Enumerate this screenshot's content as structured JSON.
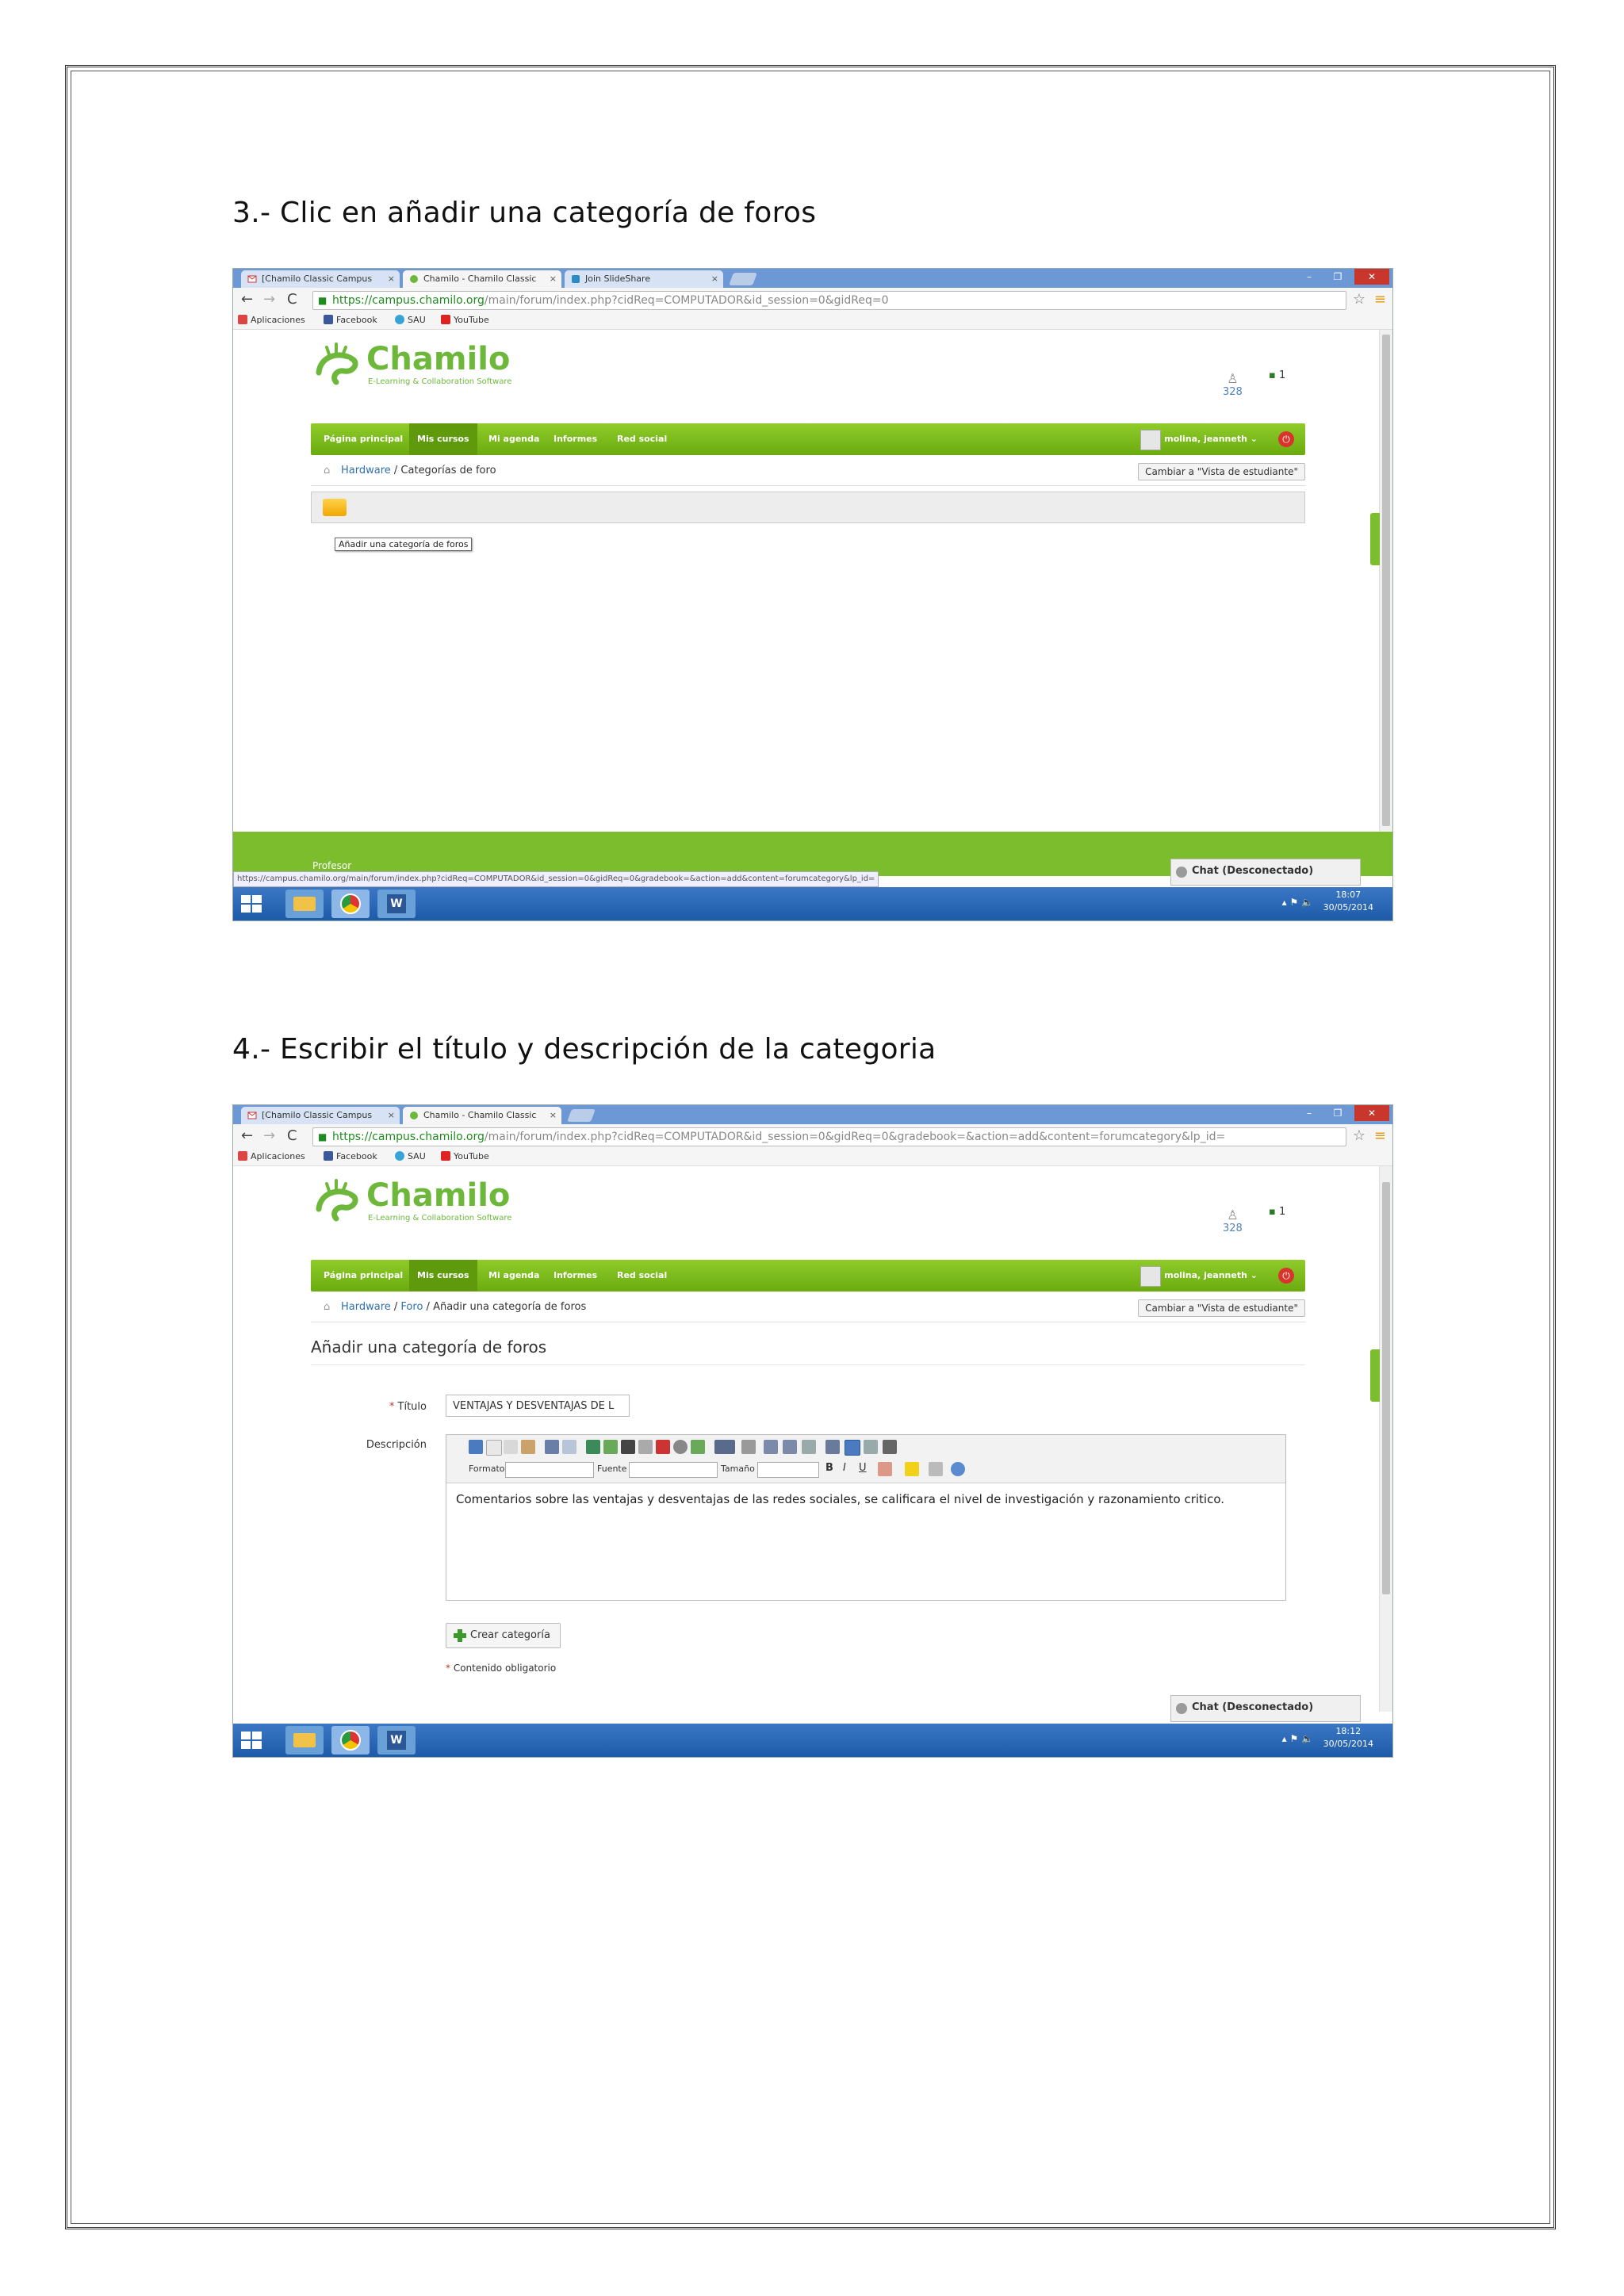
{
  "steps": [
    {
      "heading": "3.- Clic en añadir una categoría de foros"
    },
    {
      "heading": "4.- Escribir el título y descripción de la categoria"
    }
  ],
  "browser": {
    "tabs": [
      "[Chamilo Classic Campus",
      "Chamilo - Chamilo Classic",
      "Join SlideShare"
    ],
    "url_1_host": "https://campus.chamilo.org",
    "url_1_path": "/main/forum/index.php?cidReq=COMPUTADOR&id_session=0&gidReq=0",
    "url_2_path": "/main/forum/index.php?cidReq=COMPUTADOR&id_session=0&gidReq=0&gradebook=&action=add&content=forumcategory&lp_id=",
    "bookmarks": [
      "Aplicaciones",
      "Facebook",
      "SAU",
      "YouTube"
    ]
  },
  "site": {
    "logo_word": "Chamilo",
    "logo_sub": "E-Learning & Collaboration Software",
    "users_count": "328",
    "online_count": "1",
    "menu": [
      "Página principal",
      "Mis cursos",
      "Mi agenda",
      "Informes",
      "Red social"
    ],
    "user": "molina, jeanneth",
    "student_view": "Cambiar a \"Vista de estudiante\"",
    "chat": "Chat (Desconectado)",
    "footer_partial": "Profesor"
  },
  "screen1": {
    "crumb_link": "Hardware",
    "crumb_current": "Categorías de foro",
    "tooltip": "Añadir una categoría de foros",
    "status_url": "https://campus.chamilo.org/main/forum/index.php?cidReq=COMPUTADOR&id_session=0&gidReq=0&gradebook=&action=add&content=forumcategory&lp_id=",
    "time": "18:07",
    "date": "30/05/2014"
  },
  "screen2": {
    "crumb_link1": "Hardware",
    "crumb_link2": "Foro",
    "crumb_current": "Añadir una categoría de foros",
    "form_title": "Añadir una categoría de foros",
    "title_label": "Título",
    "title_value": "VENTAJAS Y DESVENTAJAS DE L",
    "desc_label": "Descripción",
    "editor_format": "Formato",
    "editor_font": "Fuente",
    "editor_size": "Tamaño",
    "description": "Comentarios sobre las ventajas y desventajas de las redes sociales, se calificara el nivel de investigación y razonamiento critico.",
    "create_button": "Crear categoría",
    "mandatory": "Contenido obligatorio",
    "time": "18:12",
    "date": "30/05/2014"
  },
  "colors": {
    "brand_green": "#6db83a",
    "menu_green": "#7cbd2d",
    "taskbar_blue": "#1d5aa8"
  }
}
